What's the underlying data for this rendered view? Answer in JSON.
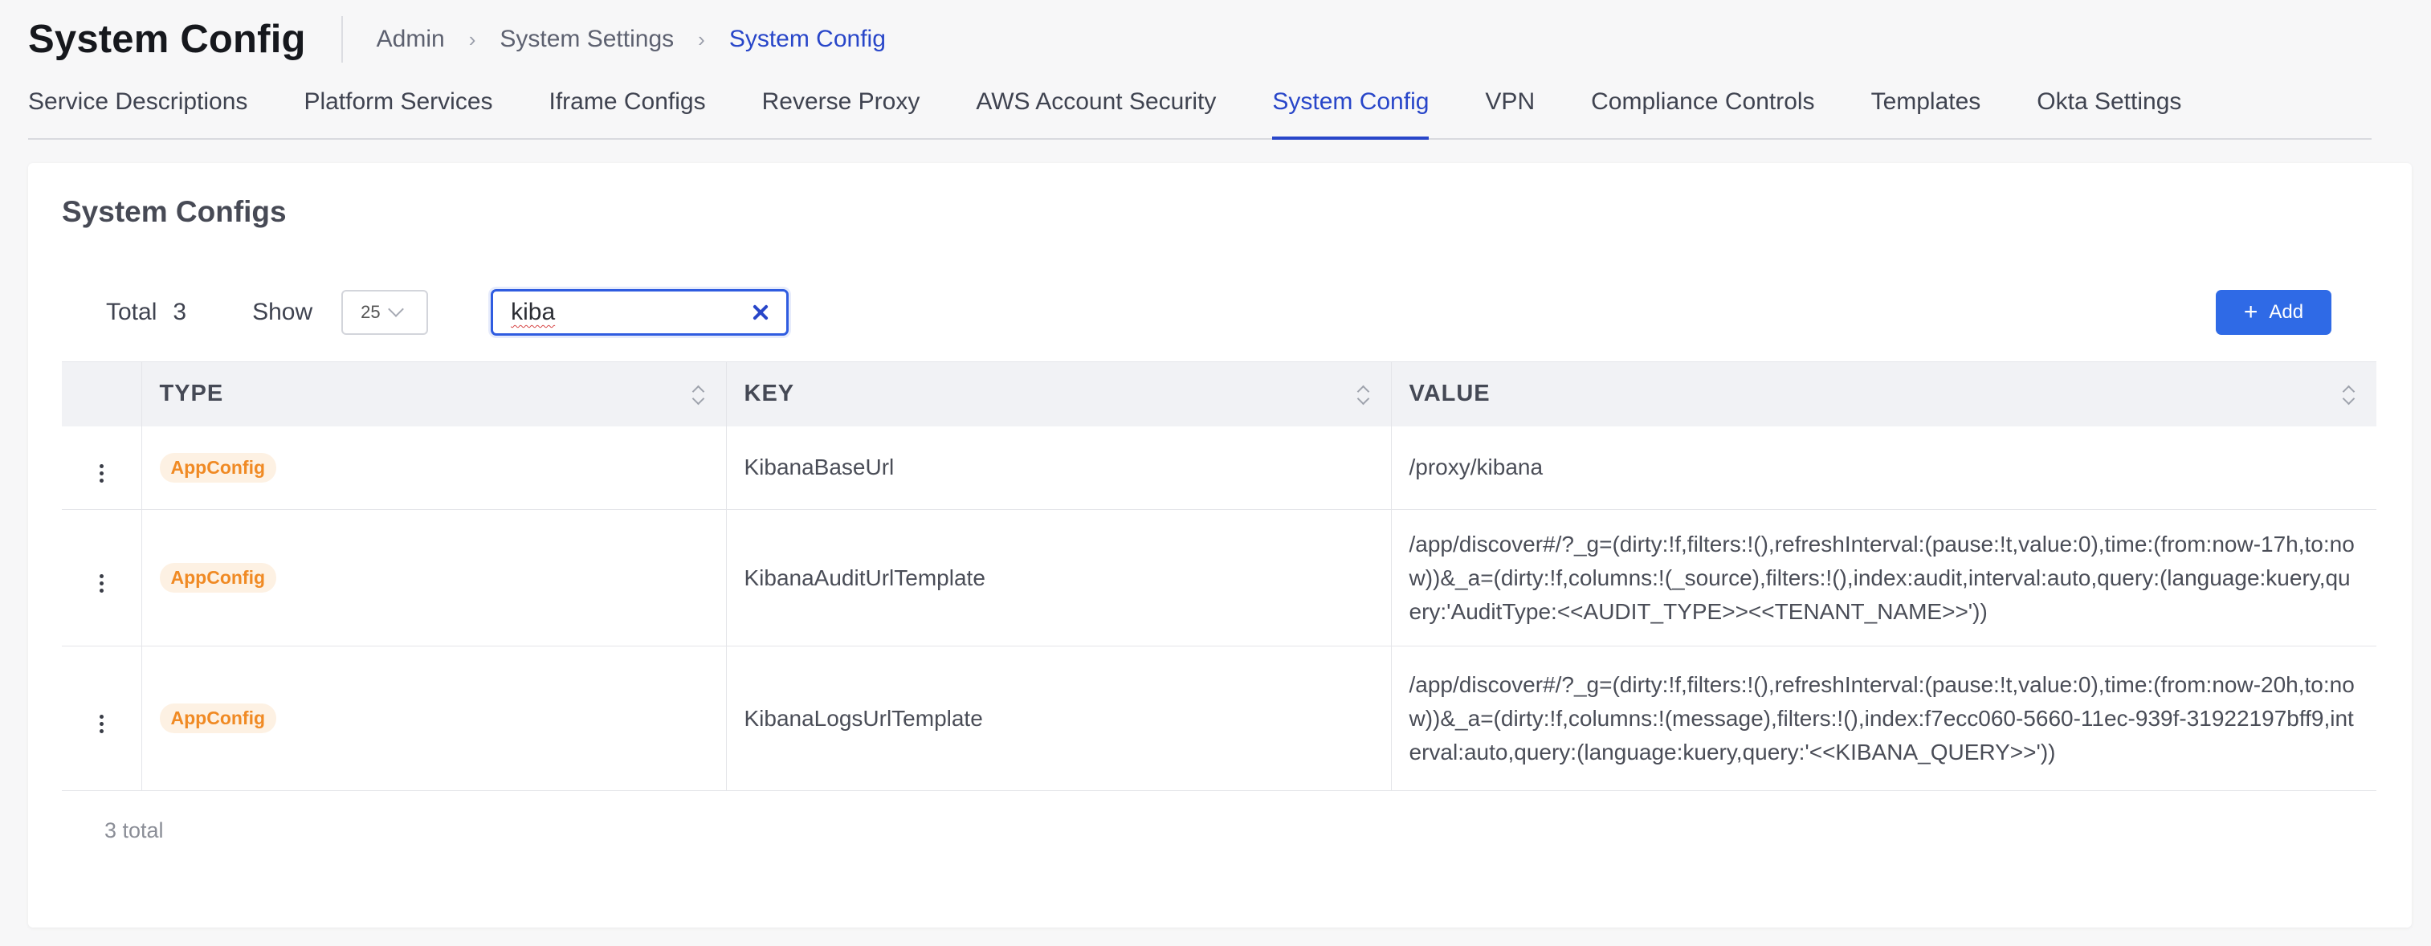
{
  "header": {
    "title": "System Config",
    "breadcrumb": [
      "Admin",
      "System Settings",
      "System Config"
    ]
  },
  "tabs": [
    {
      "label": "Service Descriptions",
      "active": false
    },
    {
      "label": "Platform Services",
      "active": false
    },
    {
      "label": "Iframe Configs",
      "active": false
    },
    {
      "label": "Reverse Proxy",
      "active": false
    },
    {
      "label": "AWS Account Security",
      "active": false
    },
    {
      "label": "System Config",
      "active": true
    },
    {
      "label": "VPN",
      "active": false
    },
    {
      "label": "Compliance Controls",
      "active": false
    },
    {
      "label": "Templates",
      "active": false
    },
    {
      "label": "Okta Settings",
      "active": false
    }
  ],
  "card": {
    "title": "System Configs",
    "total_label": "Total",
    "total_value": "3",
    "show_label": "Show",
    "page_size": "25",
    "search_value": "kiba",
    "add_label": "Add",
    "footer_total": "3 total"
  },
  "table": {
    "columns": [
      "TYPE",
      "KEY",
      "VALUE"
    ],
    "rows": [
      {
        "type": "AppConfig",
        "key": "KibanaBaseUrl",
        "value": "/proxy/kibana"
      },
      {
        "type": "AppConfig",
        "key": "KibanaAuditUrlTemplate",
        "value": "/app/discover#/?_g=(dirty:!f,filters:!(),refreshInterval:(pause:!t,value:0),time:(from:now-17h,to:now))&_a=(dirty:!f,columns:!(_source),filters:!(),index:audit,interval:auto,query:(language:kuery,query:'AuditType:<<AUDIT_TYPE>><<TENANT_NAME>>'))"
      },
      {
        "type": "AppConfig",
        "key": "KibanaLogsUrlTemplate",
        "value": "/app/discover#/?_g=(dirty:!f,filters:!(),refreshInterval:(pause:!t,value:0),time:(from:now-20h,to:now))&_a=(dirty:!f,columns:!(message),filters:!(),index:f7ecc060-5660-11ec-939f-31922197bff9,interval:auto,query:(language:kuery,query:'<<KIBANA_QUERY>>'))"
      }
    ]
  },
  "colors": {
    "accent": "#2846c9",
    "button": "#2f6ae6",
    "badge_text": "#f08a24",
    "badge_bg": "#fdf1e3"
  }
}
